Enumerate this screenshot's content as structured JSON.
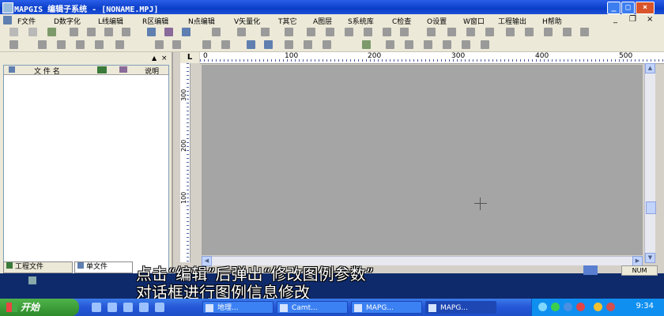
{
  "window": {
    "title": "MAPGIS 编辑子系统 - [NONAME.MPJ]",
    "controls": {
      "minimize": "_",
      "maximize": "□",
      "close": "×"
    }
  },
  "menu": {
    "items": [
      "F文件",
      "D数字化",
      "L线编辑",
      "R区编辑",
      "N点编辑",
      "V矢量化",
      "T其它",
      "A图层",
      "S系统库",
      "C检查",
      "O设置",
      "W窗口",
      "工程输出",
      "H帮助"
    ],
    "mdi_controls": [
      "_",
      "❐",
      "×"
    ]
  },
  "left_panel": {
    "header_controls": [
      "▲",
      "×"
    ],
    "columns": [
      "文 件 名",
      "",
      "说明"
    ],
    "tabs": [
      "工程文件",
      "单文件"
    ]
  },
  "ruler": {
    "corner": "L",
    "h_labels": [
      "0",
      "100",
      "200",
      "300",
      "400",
      "500"
    ],
    "v_labels": [
      "300",
      "200",
      "100"
    ]
  },
  "status": {
    "num": "NUM"
  },
  "subtitles": {
    "line1": "点击“编辑”后弹出“修改图例参数”",
    "line2": "对话框进行图例信息修改"
  },
  "taskbar": {
    "start": "开始",
    "tasks": [
      "地理...",
      "Camt...",
      "MAPG...",
      "MAPG..."
    ],
    "clock": "9:34"
  },
  "colors": {
    "title_bar": "#0a3ec8",
    "canvas": "#a5a5a5",
    "taskbar": "#2456d6",
    "start": "#2e8b2a"
  }
}
